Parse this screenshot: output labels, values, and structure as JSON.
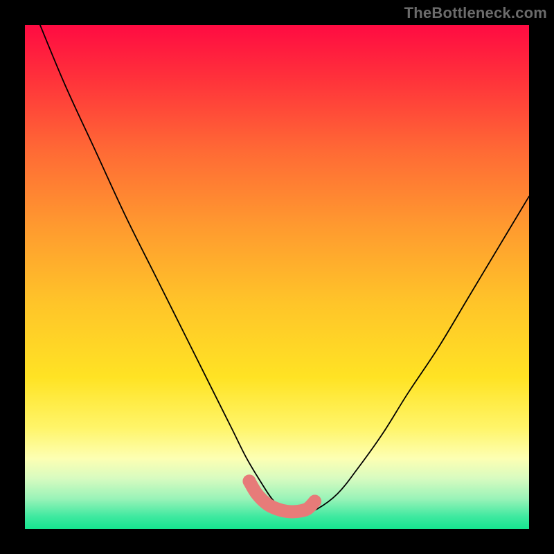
{
  "watermark": "TheBottleneck.com",
  "accent": {
    "dot_color": "#e77b79",
    "curve_color": "#000000"
  },
  "chart_data": {
    "type": "line",
    "title": "",
    "xlabel": "",
    "ylabel": "",
    "xlim": [
      0,
      100
    ],
    "ylim": [
      0,
      100
    ],
    "grid": false,
    "legend": false,
    "background": {
      "type": "vertical-gradient",
      "stops": [
        {
          "pos": 0.0,
          "color": "#ff0b42"
        },
        {
          "pos": 0.1,
          "color": "#ff2f3b"
        },
        {
          "pos": 0.25,
          "color": "#ff6a35"
        },
        {
          "pos": 0.4,
          "color": "#ff9a2f"
        },
        {
          "pos": 0.55,
          "color": "#ffc429"
        },
        {
          "pos": 0.7,
          "color": "#ffe324"
        },
        {
          "pos": 0.8,
          "color": "#fff56a"
        },
        {
          "pos": 0.86,
          "color": "#fdffb3"
        },
        {
          "pos": 0.9,
          "color": "#d7fbc0"
        },
        {
          "pos": 0.94,
          "color": "#99f3b8"
        },
        {
          "pos": 0.975,
          "color": "#3fe9a0"
        },
        {
          "pos": 1.0,
          "color": "#15e58f"
        }
      ]
    },
    "series": [
      {
        "name": "bottleneck-curve",
        "x": [
          3,
          8,
          14,
          20,
          26,
          32,
          37,
          41,
          44,
          47,
          49,
          51,
          53,
          55,
          58,
          62,
          66,
          71,
          76,
          82,
          88,
          94,
          100
        ],
        "y": [
          100,
          88,
          75,
          62,
          50,
          38,
          28,
          20,
          14,
          9,
          6,
          4,
          3,
          3,
          4,
          7,
          12,
          19,
          27,
          36,
          46,
          56,
          66
        ]
      }
    ],
    "highlight_segment": {
      "name": "sweet-spot",
      "x": [
        44.5,
        46,
        48,
        50,
        52,
        54,
        56,
        57.5
      ],
      "y": [
        9.5,
        7,
        5,
        4,
        3.5,
        3.5,
        4,
        5.5
      ],
      "dot_radius": 1.3,
      "stroke_width": 2.6
    }
  }
}
